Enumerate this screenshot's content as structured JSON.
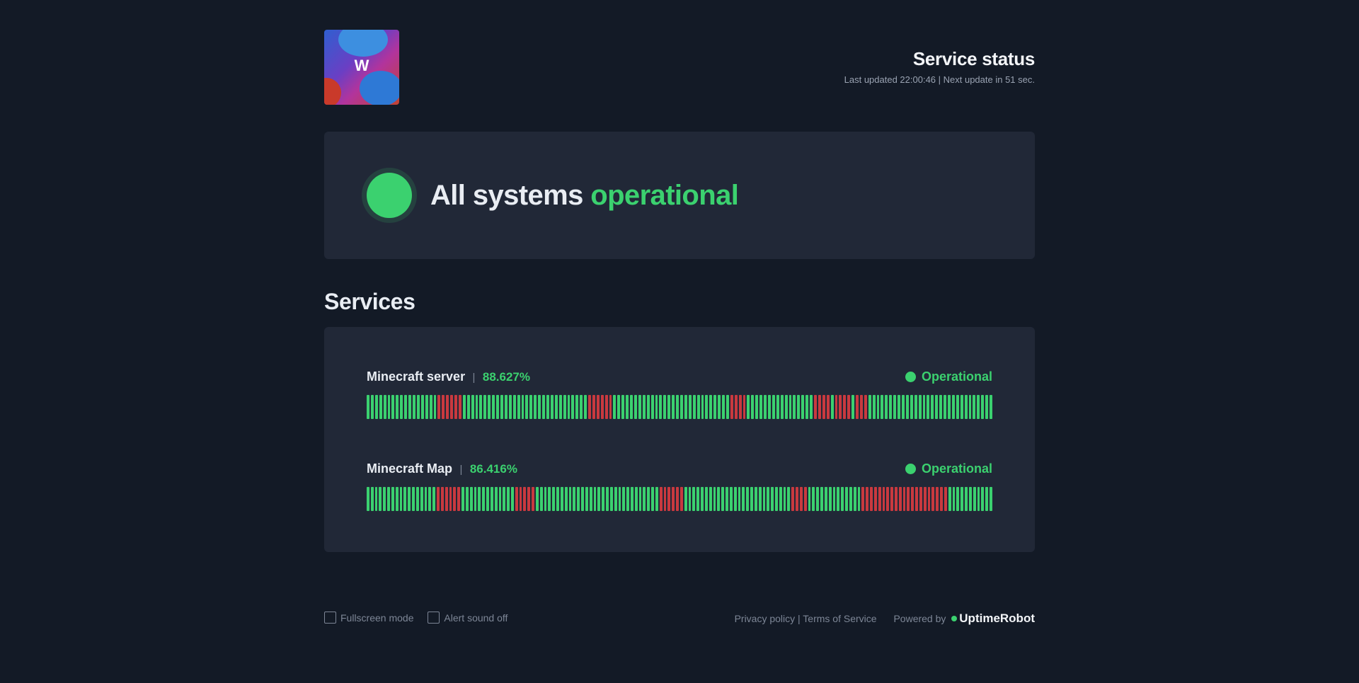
{
  "header": {
    "logo_letter": "W",
    "title": "Service status",
    "subtitle": "Last updated 22:00:46 | Next update in 51 sec."
  },
  "overall": {
    "prefix": "All systems",
    "status": "operational"
  },
  "services_title": "Services",
  "services": [
    {
      "name": "Minecraft server",
      "separator": "|",
      "uptime": "88.627%",
      "status": "Operational",
      "bars": "GGGGGGGGGGGGGGGGGRRRRRRGGGGGGGGGGGGGGGGGGGGGGGGGGGGGGRRRRRRGGGGGGGGGGGGGGGGGGGGGGGGGGGGRRRRGGGGGGGGGGGGGGGGRRRRGRRRRGRRRGGGGGGGGGGGGGGGGGGGGGGGGGGGGGG"
    },
    {
      "name": "Minecraft Map",
      "separator": "|",
      "uptime": "86.416%",
      "status": "Operational",
      "bars": "GGGGGGGGGGGGGGGGGRRRRRRGGGGGGGGGGGGGRRRRRGGGGGGGGGGGGGGGGGGGGGGGGGGGGGGRRRRRRGGGGGGGGGGGGGGGGGGGGGGGGGGRRRRGGGGGGGGGGGGGRRRRRRRRRRRRRRRRRRRRRGGGGGGGGGGG"
    }
  ],
  "bar_colors": {
    "G": "#3bd16f",
    "R": "#c9393f",
    "O": "#e58a2c",
    "X": "#2b3344"
  },
  "footer": {
    "fullscreen": "Fullscreen mode",
    "alert": "Alert sound off",
    "privacy": "Privacy policy | Terms of Service",
    "powered": "Powered by",
    "brand": "UptimeRobot"
  }
}
